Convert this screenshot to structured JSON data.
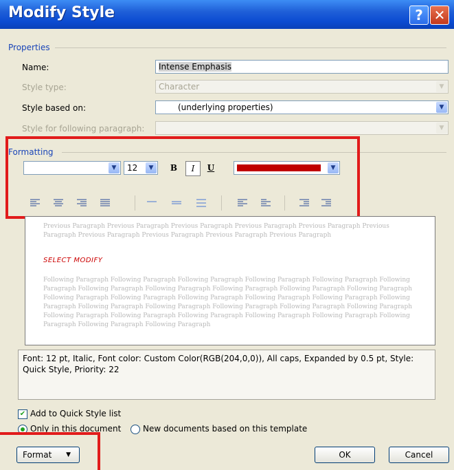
{
  "window": {
    "title": "Modify Style",
    "help_glyph": "?",
    "close_glyph": "✕"
  },
  "properties": {
    "group_label": "Properties",
    "name_label": "Name:",
    "name_value": "Intense Emphasis",
    "style_type_label": "Style type:",
    "style_type_value": "Character",
    "based_on_label": "Style based on:",
    "based_on_value": "(underlying properties)",
    "following_label": "Style for following paragraph:",
    "following_value": ""
  },
  "formatting": {
    "group_label": "Formatting",
    "font_value": "",
    "size_value": "12",
    "bold_label": "B",
    "italic_label": "I",
    "underline_label": "U",
    "font_color": "#c00000"
  },
  "preview": {
    "previous_text": "Previous Paragraph Previous Paragraph Previous Paragraph Previous Paragraph Previous Paragraph Previous Paragraph Previous Paragraph Previous Paragraph Previous Paragraph Previous Paragraph",
    "sample_text": "SELECT MODIFY",
    "following_text": "Following Paragraph Following Paragraph Following Paragraph Following Paragraph Following Paragraph Following Paragraph Following Paragraph Following Paragraph Following Paragraph Following Paragraph Following Paragraph Following Paragraph Following Paragraph Following Paragraph Following Paragraph Following Paragraph Following Paragraph Following Paragraph Following Paragraph Following Paragraph Following Paragraph Following Paragraph Following Paragraph Following Paragraph Following Paragraph Following Paragraph Following Paragraph Following Paragraph Following Paragraph Following Paragraph"
  },
  "description": "Font: 12 pt, Italic, Font color: Custom Color(RGB(204,0,0)), All caps, Expanded by  0.5 pt, Style: Quick Style, Priority: 22",
  "options": {
    "add_quick_style": "Add to Quick Style list",
    "only_this_doc": "Only in this document",
    "new_docs": "New documents based on this template"
  },
  "buttons": {
    "format": "Format",
    "ok": "OK",
    "cancel": "Cancel"
  },
  "colors": {
    "highlight": "#e11b1b",
    "title_bar": "#1f5fd8",
    "group_label": "#1a45b8"
  }
}
